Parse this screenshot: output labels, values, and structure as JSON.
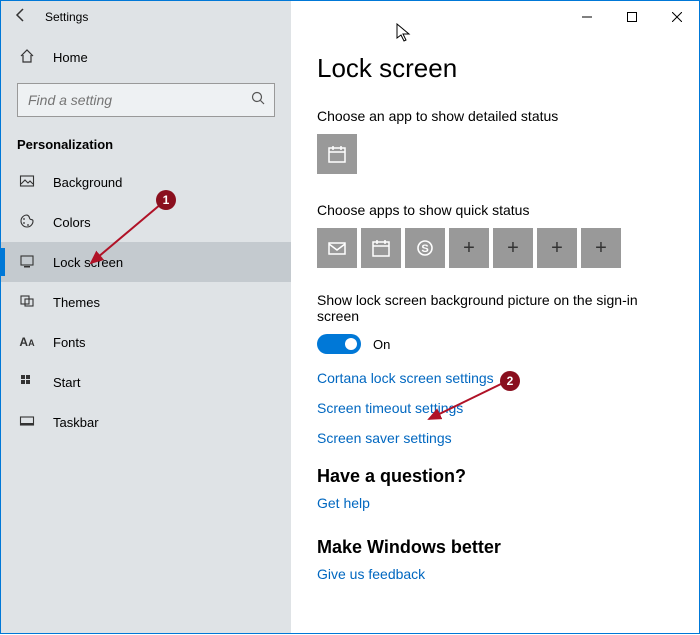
{
  "window": {
    "title": "Settings"
  },
  "sidebar": {
    "home": "Home",
    "search_placeholder": "Find a setting",
    "category": "Personalization",
    "items": [
      {
        "icon": "image-icon",
        "label": "Background"
      },
      {
        "icon": "palette-icon",
        "label": "Colors"
      },
      {
        "icon": "lock-icon",
        "label": "Lock screen"
      },
      {
        "icon": "themes-icon",
        "label": "Themes"
      },
      {
        "icon": "fonts-icon",
        "label": "Fonts"
      },
      {
        "icon": "start-icon",
        "label": "Start"
      },
      {
        "icon": "taskbar-icon",
        "label": "Taskbar"
      }
    ]
  },
  "main": {
    "title": "Lock screen",
    "detailed_label": "Choose an app to show detailed status",
    "detailed_app": "calendar-icon",
    "quick_label": "Choose apps to show quick status",
    "quick_apps": [
      "mail-icon",
      "calendar-icon",
      "skype-icon",
      "plus",
      "plus",
      "plus",
      "plus"
    ],
    "bg_toggle_label": "Show lock screen background picture on the sign-in screen",
    "bg_toggle_value": "On",
    "links": [
      "Cortana lock screen settings",
      "Screen timeout settings",
      "Screen saver settings"
    ],
    "question_heading": "Have a question?",
    "question_link": "Get help",
    "feedback_heading": "Make Windows better",
    "feedback_link": "Give us feedback"
  },
  "annotations": {
    "badge1": "1",
    "badge2": "2"
  }
}
